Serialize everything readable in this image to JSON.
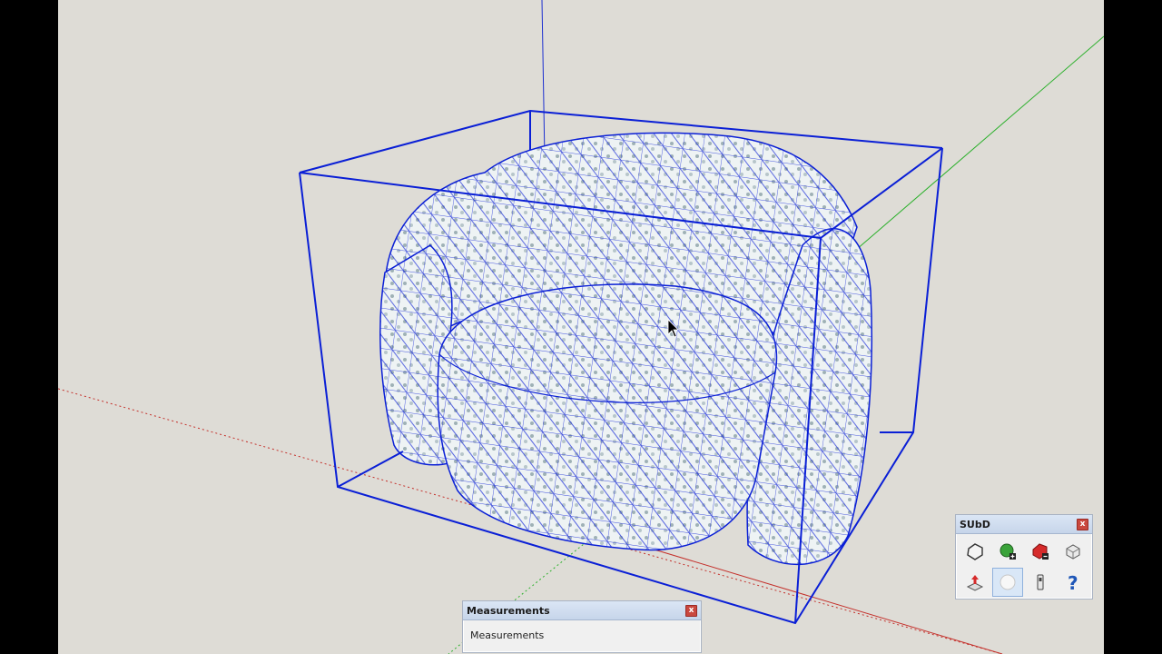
{
  "toolbar": {
    "title": "SUbD",
    "close_label": "x",
    "tools": [
      {
        "icon": "subd-toggle-icon"
      },
      {
        "icon": "add-crease-icon"
      },
      {
        "icon": "remove-crease-icon"
      },
      {
        "icon": "subd-convert-icon"
      },
      {
        "icon": "extrude-icon"
      },
      {
        "icon": "smooth-icon"
      },
      {
        "icon": "settings-icon"
      },
      {
        "icon": "help-icon"
      }
    ]
  },
  "measurements": {
    "title": "Measurements",
    "close_label": "x",
    "label": "Measurements"
  },
  "colors": {
    "viewport_bg": "#dedcd6",
    "wire": "#0a1fd6",
    "axis_red": "#c4302b",
    "axis_green": "#2bb02b",
    "axis_blue": "#1c2fd0"
  }
}
